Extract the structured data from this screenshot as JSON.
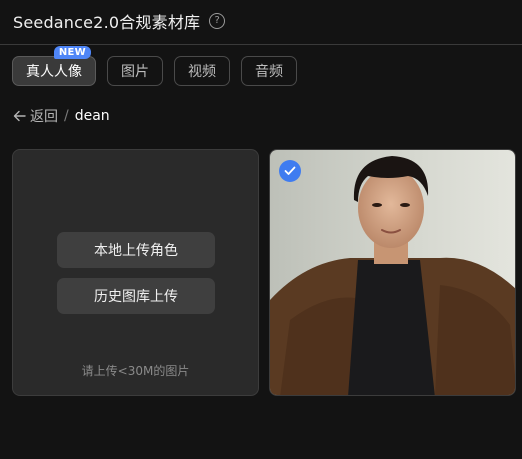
{
  "header": {
    "title": "Seedance2.0合规素材库"
  },
  "tabs": [
    {
      "label": "真人人像",
      "badge": "NEW",
      "active": true
    },
    {
      "label": "图片"
    },
    {
      "label": "视频"
    },
    {
      "label": "音频"
    }
  ],
  "breadcrumb": {
    "back_label": "返回",
    "separator": "/",
    "current": "dean"
  },
  "upload": {
    "local_button": "本地上传角色",
    "history_button": "历史图库上传",
    "hint": "请上传<30M的图片"
  },
  "photo": {
    "selected": true
  },
  "colors": {
    "accent": "#3f7cf0",
    "badge": "#4f86f7",
    "background": "#131313"
  }
}
